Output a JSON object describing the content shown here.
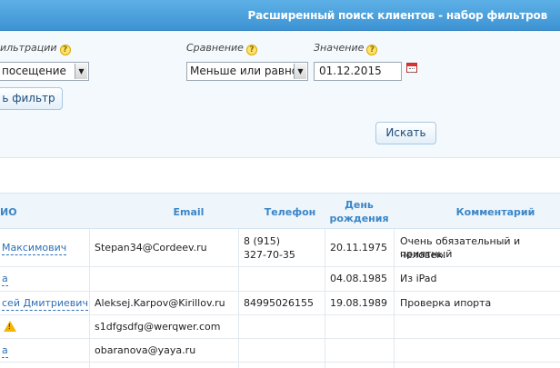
{
  "header": {
    "title": "Расширенный поиск клиентов - набор фильтров"
  },
  "filters": {
    "param_label": "ильтрации",
    "compare_label": "Сравнение",
    "value_label": "Значение",
    "param_value": "посещение",
    "compare_value": "Меньше или равно",
    "date_value": "01.12.2015",
    "add_filter": "ь фильтр",
    "search": "Искать",
    "help_glyph": "?"
  },
  "table": {
    "headers": {
      "fio": "ИО",
      "email": "Email",
      "phone": "Телефон",
      "birthday_line1": "День",
      "birthday_line2": "рождения",
      "comment": "Комментарий"
    },
    "rows": [
      {
        "name": "Максимович",
        "email": "Stepan34@Cordeev.ru",
        "phone_line1": "8 (915)",
        "phone_line2": "327-70-35",
        "birthday": "20.11.1975",
        "comment_line1": "Очень обязательный и приятный",
        "comment_line2": "человек."
      },
      {
        "name": "а",
        "email": "",
        "phone_line1": "",
        "phone_line2": "",
        "birthday": "04.08.1985",
        "comment_line1": "Из iPad",
        "comment_line2": ""
      },
      {
        "name": "сей Дмитриевич",
        "email": "Aleksej.Karpov@Kirillov.ru",
        "phone_line1": "84995026155",
        "phone_line2": "",
        "birthday": "19.08.1989",
        "comment_line1": "Проверка ипорта",
        "comment_line2": ""
      },
      {
        "name": "",
        "email": "s1dfgsdfg@werqwer.com",
        "phone_line1": "",
        "phone_line2": "",
        "birthday": "",
        "comment_line1": "",
        "comment_line2": ""
      },
      {
        "name": "а",
        "email": "obaranova@yaya.ru",
        "phone_line1": "",
        "phone_line2": "",
        "birthday": "",
        "comment_line1": "",
        "comment_line2": ""
      }
    ],
    "warning_glyph": "!"
  }
}
